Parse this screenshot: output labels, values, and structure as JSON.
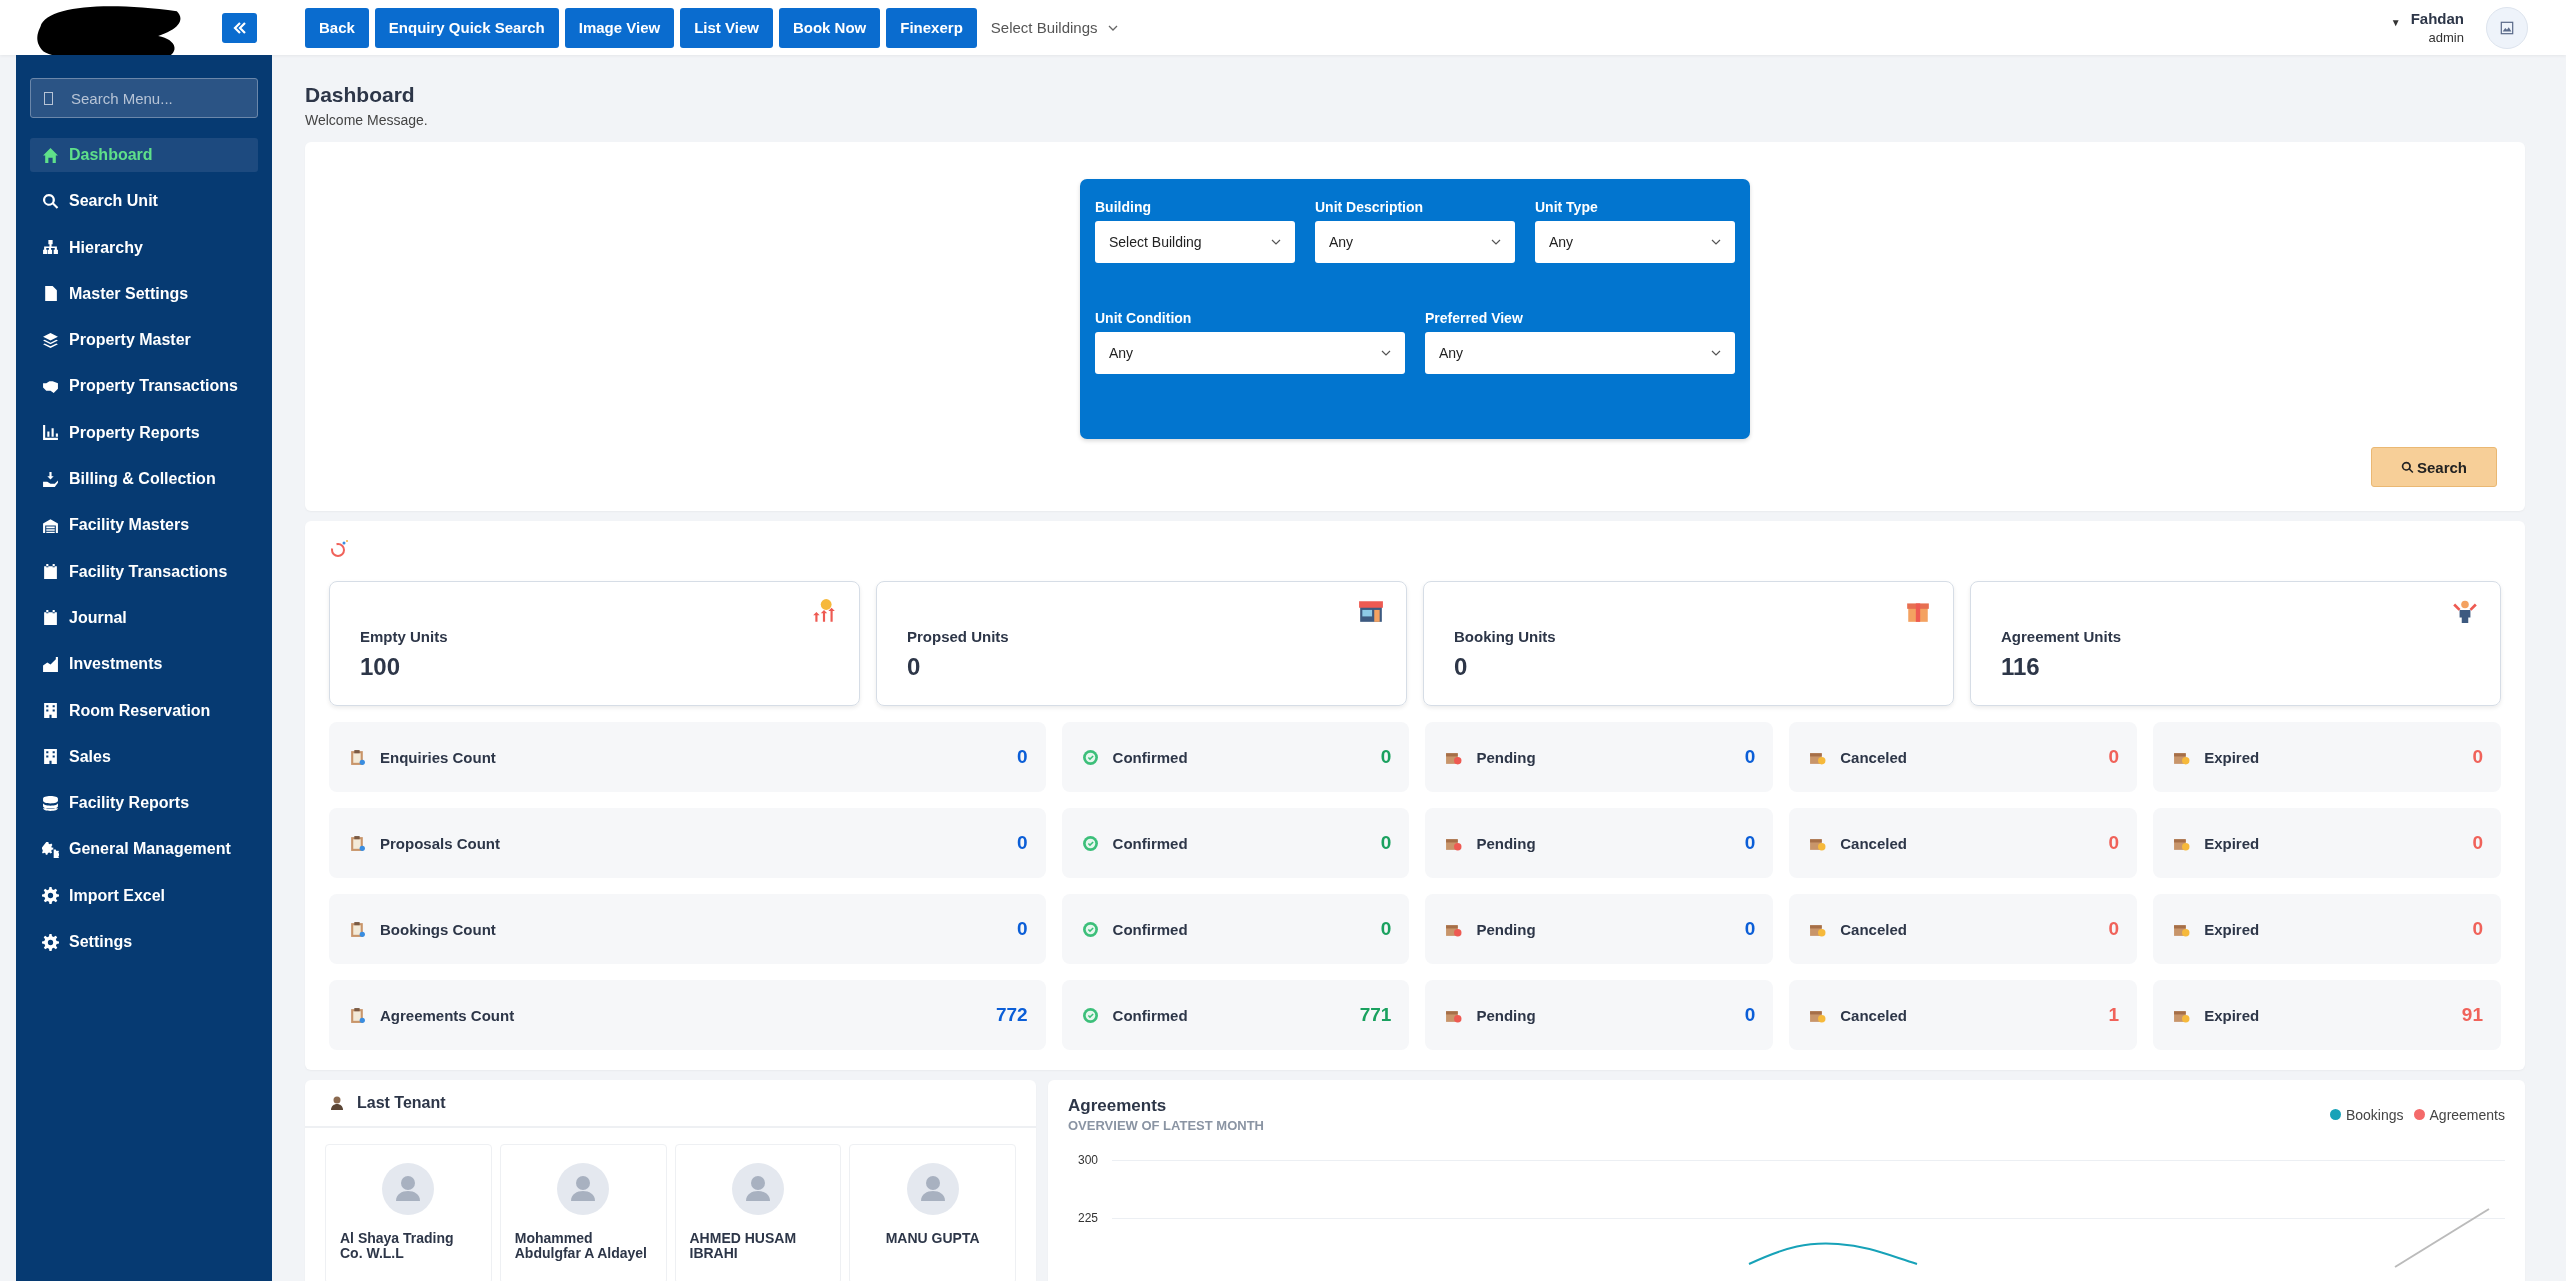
{
  "topbar": {
    "buttons": [
      "Back",
      "Enquiry Quick Search",
      "Image View",
      "List View",
      "Book Now",
      "Finexerp"
    ],
    "building_select": "Select Buildings",
    "user": {
      "caret": "▼",
      "name": "Fahdan",
      "role": "admin"
    }
  },
  "sidebar": {
    "search": {
      "placeholder": "Search Menu..."
    },
    "items": [
      {
        "label": "Dashboard",
        "selected": true
      },
      {
        "label": "Search Unit",
        "selected": false
      },
      {
        "label": "Hierarchy",
        "selected": false
      },
      {
        "label": "Master Settings",
        "selected": false
      },
      {
        "label": "Property Master",
        "selected": false
      },
      {
        "label": "Property Transactions",
        "selected": false
      },
      {
        "label": "Property Reports",
        "selected": false
      },
      {
        "label": "Billing & Collection",
        "selected": false
      },
      {
        "label": "Facility Masters",
        "selected": false
      },
      {
        "label": "Facility Transactions",
        "selected": false
      },
      {
        "label": "Journal",
        "selected": false
      },
      {
        "label": "Investments",
        "selected": false
      },
      {
        "label": "Room Reservation",
        "selected": false
      },
      {
        "label": "Sales",
        "selected": false
      },
      {
        "label": "Facility Reports",
        "selected": false
      },
      {
        "label": "General Management",
        "selected": false
      },
      {
        "label": "Import Excel",
        "selected": false
      },
      {
        "label": "Settings",
        "selected": false
      }
    ]
  },
  "page": {
    "title": "Dashboard",
    "subtitle": "Welcome Message."
  },
  "filters": {
    "row_1": [
      {
        "label": "Building",
        "value": "Select Building"
      },
      {
        "label": "Unit Description",
        "value": "Any"
      },
      {
        "label": "Unit Type",
        "value": "Any"
      }
    ],
    "row_2": [
      {
        "label": "Unit Condition",
        "value": "Any"
      },
      {
        "label": "Preferred View",
        "value": "Any"
      }
    ],
    "search_button": "Search"
  },
  "unit_cards": [
    {
      "label": "Empty Units",
      "value": "100"
    },
    {
      "label": "Propsed Units",
      "value": "0"
    },
    {
      "label": "Booking Units",
      "value": "0"
    },
    {
      "label": "Agreement Units",
      "value": "116"
    }
  ],
  "count_rows": [
    [
      {
        "kind": "count",
        "label": "Enquiries Count",
        "value": "0"
      },
      {
        "kind": "confirmed",
        "label": "Confirmed",
        "value": "0"
      },
      {
        "kind": "pending",
        "label": "Pending",
        "value": "0"
      },
      {
        "kind": "canceled",
        "label": "Canceled",
        "value": "0"
      },
      {
        "kind": "expired",
        "label": "Expired",
        "value": "0"
      }
    ],
    [
      {
        "kind": "count",
        "label": "Proposals Count",
        "value": "0"
      },
      {
        "kind": "confirmed",
        "label": "Confirmed",
        "value": "0"
      },
      {
        "kind": "pending",
        "label": "Pending",
        "value": "0"
      },
      {
        "kind": "canceled",
        "label": "Canceled",
        "value": "0"
      },
      {
        "kind": "expired",
        "label": "Expired",
        "value": "0"
      }
    ],
    [
      {
        "kind": "count",
        "label": "Bookings Count",
        "value": "0"
      },
      {
        "kind": "confirmed",
        "label": "Confirmed",
        "value": "0"
      },
      {
        "kind": "pending",
        "label": "Pending",
        "value": "0"
      },
      {
        "kind": "canceled",
        "label": "Canceled",
        "value": "0"
      },
      {
        "kind": "expired",
        "label": "Expired",
        "value": "0"
      }
    ],
    [
      {
        "kind": "count",
        "label": "Agreements Count",
        "value": "772"
      },
      {
        "kind": "confirmed",
        "label": "Confirmed",
        "value": "771"
      },
      {
        "kind": "pending",
        "label": "Pending",
        "value": "0"
      },
      {
        "kind": "canceled",
        "label": "Canceled",
        "value": "1"
      },
      {
        "kind": "expired",
        "label": "Expired",
        "value": "91"
      }
    ]
  ],
  "last_tenant": {
    "title": "Last Tenant",
    "tenants": [
      {
        "name": "Al Shaya Trading Co. W.L.L"
      },
      {
        "name": "Mohammed Abdulgfar A Aldayel"
      },
      {
        "name": "AHMED HUSAM IBRAHI"
      },
      {
        "name": "MANU GUPTA"
      }
    ]
  },
  "agreements": {
    "title": "Agreements",
    "subtitle": "OVERVIEW OF LATEST MONTH",
    "legend": [
      {
        "label": "Bookings",
        "color": "#17a2b8"
      },
      {
        "label": "Agreements",
        "color": "#f46a6a"
      }
    ],
    "axis_labels": [
      "300",
      "225"
    ]
  }
}
